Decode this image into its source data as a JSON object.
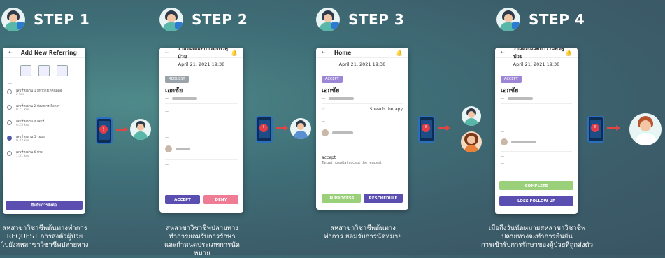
{
  "steps": [
    {
      "label": "STEP 1"
    },
    {
      "label": "STEP 2"
    },
    {
      "label": "STEP 3"
    },
    {
      "label": "STEP 4"
    }
  ],
  "phone1": {
    "title": "Add New Referring",
    "options": [
      {
        "title": "เลขที่หอผ่าน 1 มหาวายเทคนิคคือ",
        "sub": "2 km"
      },
      {
        "title": "เลขที่หอผ่าน 2 ห้องงการเลือกอร",
        "sub": "0.71 km"
      },
      {
        "title": "เลขที่หอผ่าน 4 เลขที่",
        "sub": "0.25 km"
      },
      {
        "title": "เลขที่หอผ่าน 5 รอบอ",
        "sub": "0.43 km"
      },
      {
        "title": "เลขที่หอผ่าน 6 บ่าง",
        "sub": "1.51 km"
      }
    ],
    "button": "ยืนยันการส่งต่อ"
  },
  "phone2": {
    "title": "รายละเอียดการส่งตัวผู้ป่วย",
    "date": "April 21, 2021 19:38",
    "tag": "REQUEST",
    "name": "เอกชัย",
    "accept": "ACCEPT",
    "deny": "DENY"
  },
  "phone3": {
    "title": "Home",
    "date": "April 21, 2021 19:38",
    "tag": "ACCEPT",
    "name": "เอกชัย",
    "therapy": "Speech therapy",
    "accepted": "accept",
    "accepted_sub": "Target hospital accept the request",
    "inprocess": "IN PROCESS",
    "reschedule": "RESCHEDULE"
  },
  "phone4": {
    "title": "รายละเอียดการรับตัวผู้ป่วย",
    "date": "April 21, 2021 19:38",
    "tag": "ACCEPT",
    "name": "เอกชัย",
    "complete": "COMPLETE",
    "lossfollow": "LOSS FOLLOW UP"
  },
  "captions": [
    [
      "สหสาขาวิชาชีพต้นทางทำการ",
      "REQUEST การส่งตัวผู้ป่วย",
      "ไปยังสหสาขาวิชาชีพปลายทาง"
    ],
    [
      "สหสาขาวิชาชีพปลายทาง",
      "ทำการยอมรับการรักษา",
      "และกำหนดประเภทการนัดหมาย"
    ],
    [
      "สหสาขาวิชาชีพต้นทาง",
      "ทำการ ยอมรับการนัดหมาย"
    ],
    [
      "เมื่อถึงวันนัดหมายสหสาขาวิชาชีพ",
      "ปลายทางจะทำการยืนยัน",
      "การเข้ารับการรักษาของผู้ป่วยที่ถูกส่งตัว"
    ]
  ],
  "colors": {
    "accent_purple": "#5a4fb0",
    "accept_green": "#9bd07a",
    "deny_pink": "#f07b95",
    "alert_red": "#e23e4a"
  }
}
